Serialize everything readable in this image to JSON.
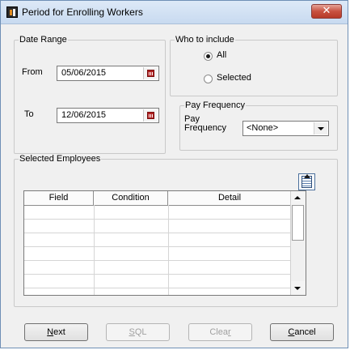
{
  "window": {
    "title": "Period for Enrolling Workers",
    "close_glyph": "✕"
  },
  "date_range": {
    "legend": "Date Range",
    "from_label": "From",
    "from_value": "05/06/2015",
    "to_label": "To",
    "to_value": "12/06/2015",
    "calendar_icon": "calendar-icon"
  },
  "who_to_include": {
    "legend": "Who to include",
    "options": [
      {
        "label": "All",
        "selected": true
      },
      {
        "label": "Selected",
        "selected": false
      }
    ]
  },
  "pay_frequency": {
    "legend": "Pay Frequency",
    "label_line1": "Pay",
    "label_line2": "Frequency",
    "value": "<None>"
  },
  "selected_employees": {
    "legend": "Selected Employees",
    "query_icon": "query-builder-icon",
    "columns": [
      "Field",
      "Condition",
      "Detail"
    ],
    "rows": [
      [
        "",
        "",
        ""
      ],
      [
        "",
        "",
        ""
      ],
      [
        "",
        "",
        ""
      ],
      [
        "",
        "",
        ""
      ],
      [
        "",
        "",
        ""
      ],
      [
        "",
        "",
        ""
      ]
    ]
  },
  "buttons": {
    "next": {
      "accel": "N",
      "rest": "ext"
    },
    "sql": {
      "accel": "S",
      "rest": "QL"
    },
    "clear": {
      "start": "Clea",
      "accel": "r"
    },
    "cancel": {
      "accel": "C",
      "rest": "ancel"
    }
  },
  "colors": {
    "titlebar": "#c8daf0",
    "close_button": "#c8513f",
    "calendar_red": "#b02020",
    "dialog_bg": "#f0f0f0"
  }
}
